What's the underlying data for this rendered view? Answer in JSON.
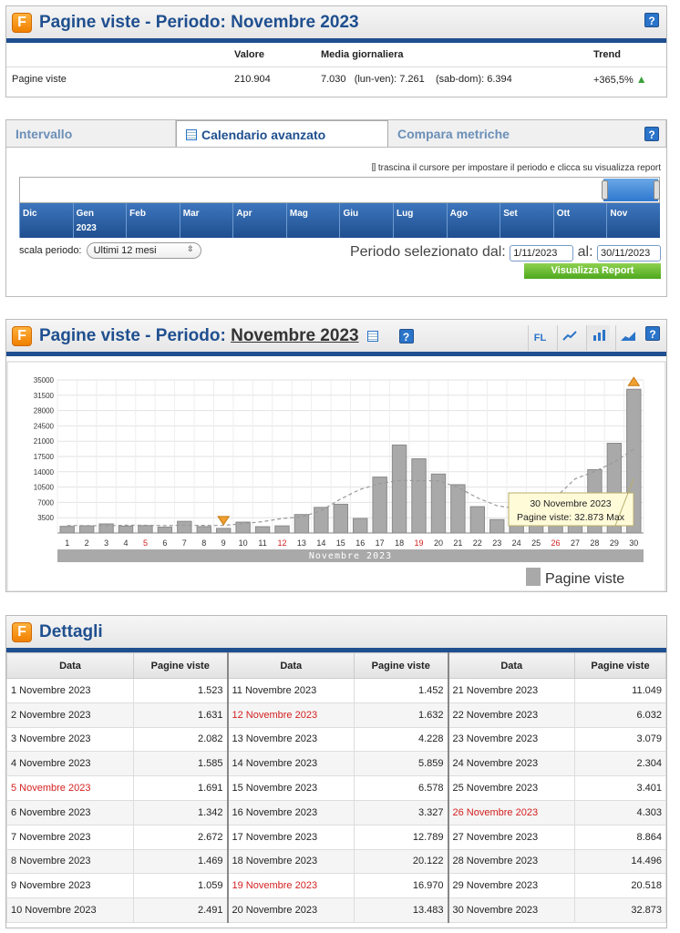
{
  "summary": {
    "title": "Pagine viste - Periodo: Novembre 2023",
    "help": "?",
    "headers": {
      "valore": "Valore",
      "media": "Media giornaliera",
      "trend": "Trend"
    },
    "row": {
      "label": "Pagine viste",
      "valore": "210.904",
      "media": "7.030",
      "lunven": "(lun-ven): 7.261",
      "sabdom": "(sab-dom): 6.394",
      "trend": "+365,5%"
    }
  },
  "calendar": {
    "tabs": [
      "Intervallo",
      "Calendario avanzato",
      "Compara metriche"
    ],
    "hint": "trascina il cursore per impostare il periodo e clicca su visualizza report",
    "months": [
      {
        "m": "Dic",
        "y": ""
      },
      {
        "m": "Gen",
        "y": "2023"
      },
      {
        "m": "Feb",
        "y": ""
      },
      {
        "m": "Mar",
        "y": ""
      },
      {
        "m": "Apr",
        "y": ""
      },
      {
        "m": "Mag",
        "y": ""
      },
      {
        "m": "Giu",
        "y": ""
      },
      {
        "m": "Lug",
        "y": ""
      },
      {
        "m": "Ago",
        "y": ""
      },
      {
        "m": "Set",
        "y": ""
      },
      {
        "m": "Ott",
        "y": ""
      },
      {
        "m": "Nov",
        "y": ""
      }
    ],
    "scale_label": "scala periodo:",
    "scale_value": "Ultimi 12 mesi",
    "period_from_label": "Periodo selezionato dal:",
    "date_from": "1/11/2023",
    "period_to_label": "al:",
    "date_to": "30/11/2023",
    "report_button": "Visualizza Report"
  },
  "chart_panel": {
    "title_prefix": "Pagine viste - Periodo:",
    "title_link": "Novembre 2023",
    "buttons": [
      "FL",
      "line-chart-icon",
      "bar-chart-icon",
      "area-chart-icon",
      "?"
    ],
    "tooltip_line1": "30 Novembre 2023",
    "tooltip_line2": "Pagine viste: 32.873 Max",
    "xaxis_band": "Novembre 2023",
    "legend": "Pagine viste"
  },
  "chart_data": {
    "type": "bar",
    "categories": [
      "1",
      "2",
      "3",
      "4",
      "5",
      "6",
      "7",
      "8",
      "9",
      "10",
      "11",
      "12",
      "13",
      "14",
      "15",
      "16",
      "17",
      "18",
      "19",
      "20",
      "21",
      "22",
      "23",
      "24",
      "25",
      "26",
      "27",
      "28",
      "29",
      "30"
    ],
    "series": [
      {
        "name": "Pagine viste",
        "values": [
          1523,
          1631,
          2082,
          1585,
          1691,
          1342,
          2672,
          1469,
          1059,
          2491,
          1452,
          1632,
          4228,
          5859,
          6578,
          3327,
          12789,
          20122,
          16970,
          13483,
          11049,
          6032,
          3079,
          2304,
          3401,
          4303,
          8864,
          14496,
          20518,
          32873
        ]
      }
    ],
    "yticks": [
      "35000",
      "31500",
      "28000",
      "24500",
      "21000",
      "17500",
      "14000",
      "10500",
      "7000",
      "3500"
    ],
    "ylim": [
      0,
      35000
    ],
    "red_days": [
      "5",
      "12",
      "19",
      "26"
    ],
    "bar_color": "#a9a9a9",
    "trend_color": "#999999"
  },
  "details": {
    "title": "Dettagli",
    "col_date": "Data",
    "col_views": "Pagine viste",
    "rows": [
      [
        "1 Novembre 2023",
        "1.523",
        "11 Novembre 2023",
        "1.452",
        "21 Novembre 2023",
        "11.049"
      ],
      [
        "2 Novembre 2023",
        "1.631",
        "12 Novembre 2023",
        "1.632",
        "22 Novembre 2023",
        "6.032"
      ],
      [
        "3 Novembre 2023",
        "2.082",
        "13 Novembre 2023",
        "4.228",
        "23 Novembre 2023",
        "3.079"
      ],
      [
        "4 Novembre 2023",
        "1.585",
        "14 Novembre 2023",
        "5.859",
        "24 Novembre 2023",
        "2.304"
      ],
      [
        "5 Novembre 2023",
        "1.691",
        "15 Novembre 2023",
        "6.578",
        "25 Novembre 2023",
        "3.401"
      ],
      [
        "6 Novembre 2023",
        "1.342",
        "16 Novembre 2023",
        "3.327",
        "26 Novembre 2023",
        "4.303"
      ],
      [
        "7 Novembre 2023",
        "2.672",
        "17 Novembre 2023",
        "12.789",
        "27 Novembre 2023",
        "8.864"
      ],
      [
        "8 Novembre 2023",
        "1.469",
        "18 Novembre 2023",
        "20.122",
        "28 Novembre 2023",
        "14.496"
      ],
      [
        "9 Novembre 2023",
        "1.059",
        "19 Novembre 2023",
        "16.970",
        "29 Novembre 2023",
        "20.518"
      ],
      [
        "10 Novembre 2023",
        "2.491",
        "20 Novembre 2023",
        "13.483",
        "30 Novembre 2023",
        "32.873"
      ]
    ],
    "red_dates": [
      "5 Novembre 2023",
      "12 Novembre 2023",
      "19 Novembre 2023",
      "26 Novembre 2023"
    ]
  }
}
